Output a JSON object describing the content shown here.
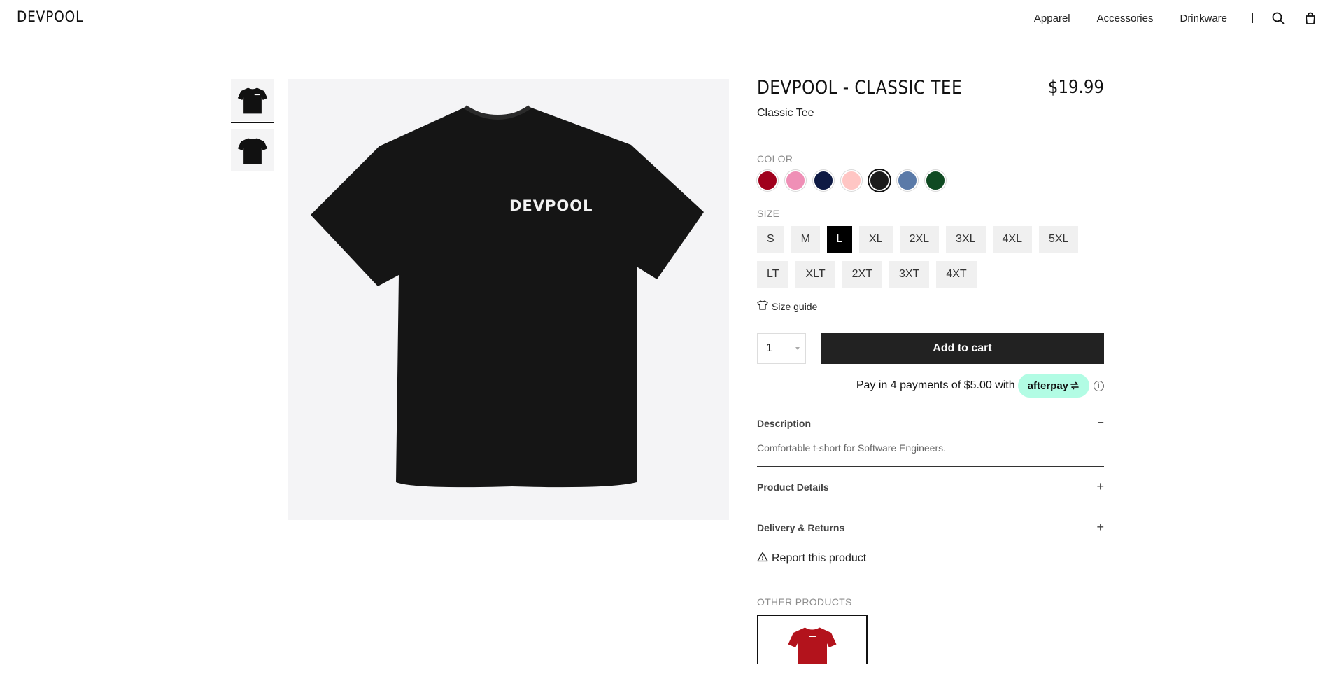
{
  "header": {
    "logo": "DEVPOOL",
    "nav": [
      "Apparel",
      "Accessories",
      "Drinkware"
    ]
  },
  "product": {
    "title": "DEVPOOL - CLASSIC TEE",
    "price": "$19.99",
    "subtitle": "Classic Tee",
    "print_text": "DEVPOOL",
    "color_label": "COLOR",
    "colors": [
      "#a0001c",
      "#ef8fb6",
      "#0e1a44",
      "#ffc6c4",
      "#1c1c1c",
      "#5a7aa8",
      "#0f4a22"
    ],
    "selected_color": "#1c1c1c",
    "size_label": "SIZE",
    "sizes": [
      "S",
      "M",
      "L",
      "XL",
      "2XL",
      "3XL",
      "4XL",
      "5XL",
      "LT",
      "XLT",
      "2XT",
      "3XT",
      "4XT"
    ],
    "selected_size": "L",
    "size_guide": "Size guide",
    "quantity": "1",
    "add_to_cart": "Add to cart",
    "afterpay": {
      "text": "Pay in 4 payments of $5.00 with",
      "brand": "afterpay",
      "info": "i"
    },
    "accordion": {
      "description_title": "Description",
      "description_text": "Comfortable t-short for Software Engineers.",
      "details_title": "Product Details",
      "delivery_title": "Delivery & Returns",
      "minus": "−",
      "plus": "+"
    },
    "report": "Report this product",
    "other_products_label": "OTHER PRODUCTS"
  }
}
